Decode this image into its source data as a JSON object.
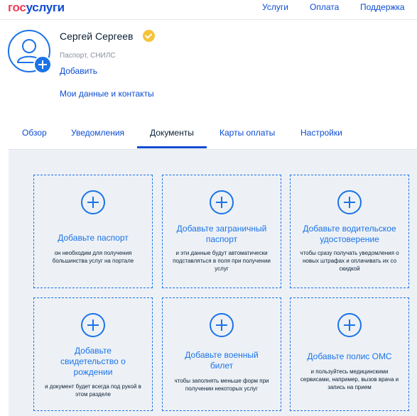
{
  "header": {
    "logo_part1": "гос",
    "logo_part2": "услуги",
    "nav": [
      "Услуги",
      "Оплата",
      "Поддержка"
    ]
  },
  "profile": {
    "name": "Сергей Сергеев",
    "doc_hint": "Паспорт, СНИЛС",
    "add_link": "Добавить",
    "contacts_link": "Мои данные и контакты"
  },
  "tabs": [
    {
      "label": "Обзор",
      "active": false
    },
    {
      "label": "Уведомления",
      "active": false
    },
    {
      "label": "Документы",
      "active": true
    },
    {
      "label": "Карты оплаты",
      "active": false
    },
    {
      "label": "Настройки",
      "active": false
    }
  ],
  "cards": [
    {
      "title": "Добавьте паспорт",
      "desc": "он необходим для получения большинства услуг на портале"
    },
    {
      "title": "Добавьте заграничный паспорт",
      "desc": "и эти данные будут автоматически подставляться в поля при получении услуг"
    },
    {
      "title": "Добавьте водительское удостоверение",
      "desc": "чтобы сразу получать уведомления о новых штрафах и оплачивать их со скидкой"
    },
    {
      "title": "Добавьте свидетельство о рождении",
      "desc": "и документ будет всегда под рукой в этом разделе"
    },
    {
      "title": "Добавьте военный билет",
      "desc": "чтобы заполнять меньше форм при получении некоторых услуг"
    },
    {
      "title": "Добавьте полис ОМС",
      "desc": "и пользуйтесь медицинскими сервисами, например, вызов врача и запись на прием"
    }
  ],
  "colors": {
    "brand_red": "#ee3f58",
    "brand_blue": "#0d4cd3",
    "accent": "#1a73e8",
    "verified_badge": "#f5c33b",
    "panel_bg": "#edf1f6"
  }
}
